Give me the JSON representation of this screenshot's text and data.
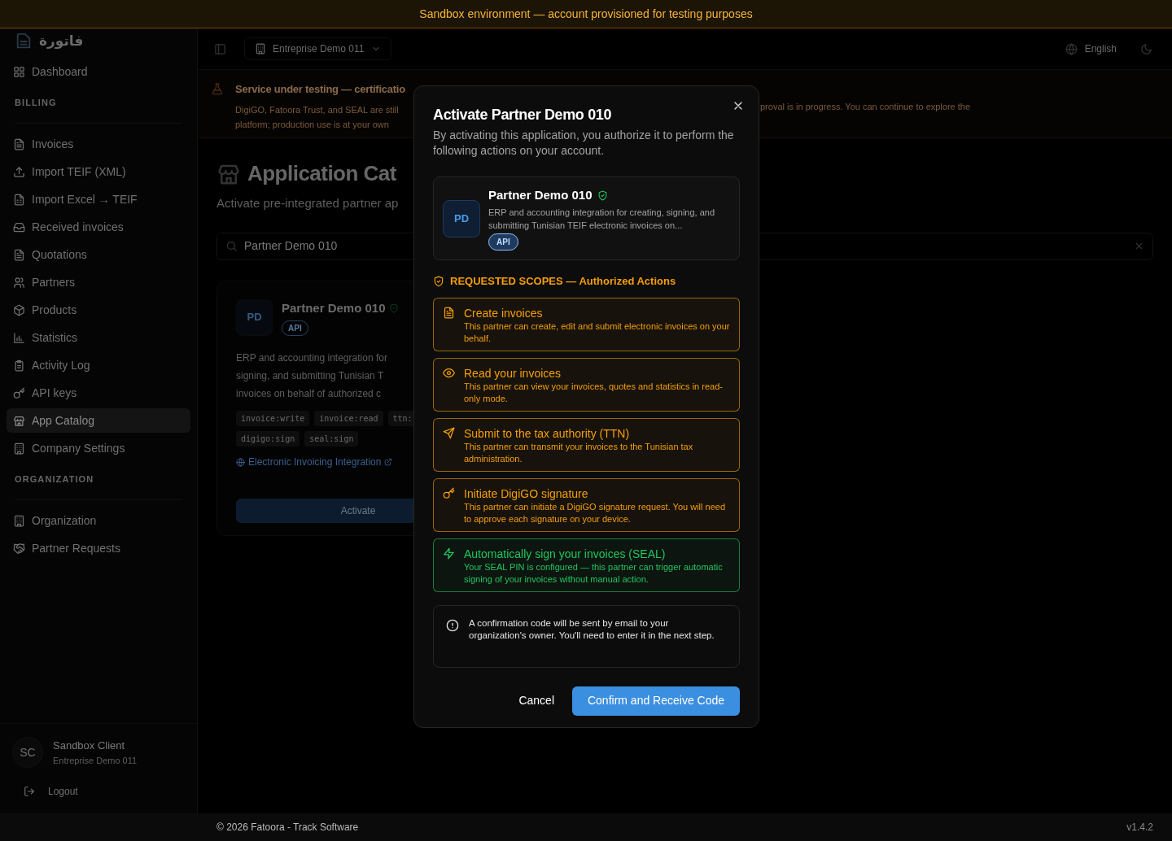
{
  "sandbox_banner": "Sandbox environment — account provisioned for testing purposes",
  "sidebar": {
    "logo": "فاتورة",
    "items": [
      {
        "kind": "item",
        "label": "Dashboard",
        "selected": false
      },
      {
        "kind": "section",
        "label": "BILLING"
      },
      {
        "kind": "item",
        "label": "Invoices",
        "selected": false
      },
      {
        "kind": "item",
        "label": "Import TEIF (XML)",
        "selected": false
      },
      {
        "kind": "item",
        "label": "Import Excel → TEIF",
        "selected": false
      },
      {
        "kind": "item",
        "label": "Received invoices",
        "selected": false
      },
      {
        "kind": "item",
        "label": "Quotations",
        "selected": false
      },
      {
        "kind": "item",
        "label": "Partners",
        "selected": false
      },
      {
        "kind": "item",
        "label": "Products",
        "selected": false
      },
      {
        "kind": "item",
        "label": "Statistics",
        "selected": false
      },
      {
        "kind": "item",
        "label": "Activity Log",
        "selected": false
      },
      {
        "kind": "item",
        "label": "API keys",
        "selected": false
      },
      {
        "kind": "item",
        "label": "App Catalog",
        "selected": true
      },
      {
        "kind": "item",
        "label": "Company Settings",
        "selected": false
      },
      {
        "kind": "section",
        "label": "ORGANIZATION"
      },
      {
        "kind": "item",
        "label": "Organization",
        "selected": false
      },
      {
        "kind": "item",
        "label": "Partner Requests",
        "selected": false
      }
    ],
    "user": {
      "initials": "SC",
      "name": "Sandbox Client",
      "company": "Entreprise Demo 011"
    },
    "logout": "Logout"
  },
  "topbar": {
    "company": "Entreprise Demo 011",
    "language": "English"
  },
  "notice": {
    "title": "Service under testing — certificatio",
    "line_1_left": "DigiGO, Fatoora Trust, and SEAL are still",
    "line_1_right": "proval is in progress. You can continue to explore the",
    "line_2_left": "platform; production use is at your own"
  },
  "page": {
    "title": "Application Cat",
    "subtitle": "Activate pre-integrated partner ap",
    "search": {
      "value": "Partner Demo 010"
    }
  },
  "partner_card": {
    "initials": "PD",
    "name": "Partner Demo 010",
    "badge": "API",
    "description_lines": [
      "ERP and accounting integration for",
      "signing, and submitting Tunisian T",
      "invoices on behalf of authorized c"
    ],
    "scopes": [
      "invoice:write",
      "invoice:read",
      "ttn:",
      "digigo:sign",
      "seal:sign"
    ],
    "link": "Electronic Invoicing Integration",
    "button": "Activate"
  },
  "modal": {
    "title": "Activate Partner Demo 010",
    "description": "By activating this application, you authorize it to perform the following actions on your account.",
    "partner": {
      "initials": "PD",
      "name": "Partner Demo 010",
      "description": "ERP and accounting integration for creating, signing, and submitting Tunisian TEIF electronic invoices on...",
      "badge": "API"
    },
    "scopes_heading": "REQUESTED SCOPES — Authorized Actions",
    "scopes": [
      {
        "title": "Create invoices",
        "description": "This partner can create, edit and submit electronic invoices on your behalf.",
        "color": "#f59e0b"
      },
      {
        "title": "Read your invoices",
        "description": "This partner can view your invoices, quotes and statistics in read-only mode.",
        "color": "#f59e0b"
      },
      {
        "title": "Submit to the tax authority (TTN)",
        "description": "This partner can transmit your invoices to the Tunisian tax administration.",
        "color": "#f59e0b"
      },
      {
        "title": "Initiate DigiGO signature",
        "description": "This partner can initiate a DigiGO signature request. You will need to approve each signature on your device.",
        "color": "#f59e0b"
      },
      {
        "title": "Automatically sign your invoices (SEAL)",
        "description": "Your SEAL PIN is configured — this partner can trigger automatic signing of your invoices without manual action.",
        "color": "#22c55e"
      }
    ],
    "info": "A confirmation code will be sent by email to your organization's owner. You'll need to enter it in the next step.",
    "cancel": "Cancel",
    "confirm": "Confirm and Receive Code"
  },
  "footer": {
    "copyright": "© 2026 Fatoora - Track Software",
    "version": "v1.4.2"
  }
}
